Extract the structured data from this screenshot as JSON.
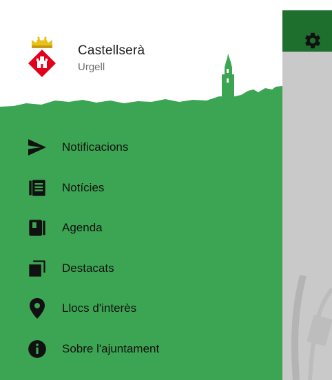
{
  "drawer": {
    "town_name": "Castellserà",
    "region": "Urgell",
    "menu": [
      {
        "label": "Notificacions",
        "icon": "send-icon"
      },
      {
        "label": "Notícies",
        "icon": "newspaper-icon"
      },
      {
        "label": "Agenda",
        "icon": "book-icon"
      },
      {
        "label": "Destacats",
        "icon": "stacked-cards-icon"
      },
      {
        "label": "Llocs d'interès",
        "icon": "location-pin-icon"
      },
      {
        "label": "Sobre l'ajuntament",
        "icon": "info-icon"
      }
    ]
  },
  "appbar": {
    "settings_icon": "gear-icon"
  },
  "colors": {
    "drawer_green": "#3ca553",
    "appbar_green": "#1e6e2e",
    "scrim_gray": "#c9c9c9",
    "crest_red": "#e2001a",
    "crown_gold": "#e8c21a"
  }
}
